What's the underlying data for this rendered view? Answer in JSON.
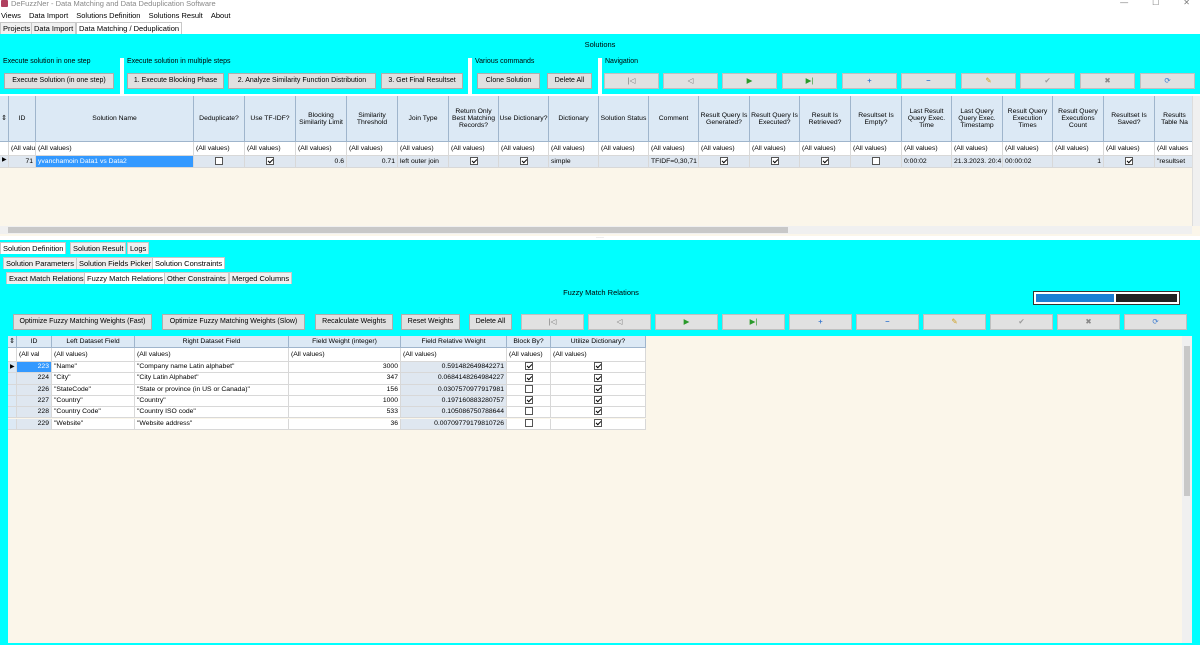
{
  "window": {
    "title": "DeFuzzNer - Data Matching and Data Deduplication Software"
  },
  "menu": [
    "Views",
    "Data Import",
    "Solutions Definition",
    "Solutions Result",
    "About"
  ],
  "main_tabs": [
    "Projects",
    "Data Import",
    "Data Matching / Deduplication"
  ],
  "solutions_header": "Solutions",
  "groups": {
    "one_step": {
      "title": "Execute solution in one step",
      "button": "Execute Solution (in one step)"
    },
    "multi_step": {
      "title": "Execute solution in multiple steps",
      "buttons": [
        "1. Execute Blocking Phase",
        "2. Analyze Similarity Function Distribution",
        "3. Get Final Resultset"
      ]
    },
    "various": {
      "title": "Various commands",
      "buttons": [
        "Clone Solution",
        "Delete All"
      ]
    },
    "navigation": {
      "title": "Navigation"
    }
  },
  "nav_icons": [
    "first-icon",
    "prev-icon",
    "next-icon",
    "last-icon",
    "add-icon",
    "remove-icon",
    "edit-icon",
    "accept-icon",
    "cancel-icon",
    "refresh-icon"
  ],
  "solutions_grid": {
    "columns": [
      "ID",
      "Solution Name",
      "Deduplicate?",
      "Use TF-IDF?",
      "Blocking Similarity Limit",
      "Similarity Threshold",
      "Join Type",
      "Return Only Best Matching Records?",
      "Use Dictionary?",
      "Dictionary",
      "Solution Status",
      "Comment",
      "Result Query Is Generated?",
      "Result Query Is Executed?",
      "Result Is Retrieved?",
      "Resultset Is Empty?",
      "Last Result Query Exec. Time",
      "Last Query Query Exec. Timestamp",
      "Result Query Execution Times",
      "Result Query Executions Count",
      "Resultset Is Saved?",
      "Results Table Na"
    ],
    "filters": [
      "(All valu",
      "(All values)",
      "(All values)",
      "(All values)",
      "(All values)",
      "(All values)",
      "(All values)",
      "(All values)",
      "(All values)",
      "(All values)",
      "(All values)",
      "(All values)",
      "(All values)",
      "(All values)",
      "(All values)",
      "(All values)",
      "(All values)",
      "(All values)",
      "(All values)",
      "(All values)",
      "(All values)",
      "(All values"
    ],
    "row": {
      "id": "71",
      "name": "yvanchamoin Data1 vs Data2",
      "dedup": false,
      "tfidf": true,
      "blocking": "0.6",
      "threshold": "0.71",
      "join": "left outer join",
      "best": true,
      "usedict": true,
      "dict": "simple",
      "status": "",
      "comment": "TFIDF=0,30,71",
      "generated": true,
      "executed": true,
      "retrieved": true,
      "empty": false,
      "exec_time": "0:00:02",
      "timestamp": "21.3.2023. 20:4",
      "exec_times": "00:00:02",
      "count": "1",
      "saved": true,
      "table": "\"resultset"
    }
  },
  "lower_tabs": [
    "Solution Definition",
    "Solution Result",
    "Logs"
  ],
  "def_tabs": [
    "Solution Parameters",
    "Solution Fields Picker",
    "Solution Constraints"
  ],
  "constraint_tabs": [
    "Exact Match Relations",
    "Fuzzy Match Relations",
    "Other Constraints",
    "Merged Columns"
  ],
  "fuzzy": {
    "header": "Fuzzy Match Relations",
    "progress": 0.55,
    "buttons": [
      "Optimize Fuzzy Matching Weights (Fast)",
      "Optimize Fuzzy Matching Weights (Slow)",
      "Recalculate Weights",
      "Reset Weights",
      "Delete All"
    ],
    "columns": [
      "ID",
      "Left Dataset Field",
      "Right Dataset Field",
      "Field Weight (integer)",
      "Field Relative Weight",
      "Block By?",
      "Utilize Dictionary?"
    ],
    "filters": [
      "(All val",
      "(All values)",
      "(All values)",
      "(All values)",
      "(All values)",
      "(All values)",
      "(All values)"
    ],
    "rows": [
      {
        "id": "223",
        "left": "\"Name\"",
        "right": "\"Company name Latin alphabet\"",
        "w": "3000",
        "rw": "0.591482649842271",
        "block": true,
        "dict": true
      },
      {
        "id": "224",
        "left": "\"City\"",
        "right": "\"City Latin Alphabet\"",
        "w": "347",
        "rw": "0.0684148264984227",
        "block": true,
        "dict": true
      },
      {
        "id": "226",
        "left": "\"StateCode\"",
        "right": "\"State or province (in US or Canada)\"",
        "w": "156",
        "rw": "0.0307570977917981",
        "block": false,
        "dict": true
      },
      {
        "id": "227",
        "left": "\"Country\"",
        "right": "\"Country\"",
        "w": "1000",
        "rw": "0.197160883280757",
        "block": true,
        "dict": true
      },
      {
        "id": "228",
        "left": "\"Country Code\"",
        "right": "\"Country ISO code\"",
        "w": "533",
        "rw": "0.105086750788644",
        "block": false,
        "dict": true
      },
      {
        "id": "229",
        "left": "\"Website\"",
        "right": "\"Website address\"",
        "w": "36",
        "rw": "0.00709779179810726",
        "block": false,
        "dict": true
      }
    ]
  },
  "colors": {
    "cyan": "#00ffff",
    "header": "#dce9f5",
    "grid_bg": "#fbf6ea",
    "sel": "#3399ff"
  }
}
